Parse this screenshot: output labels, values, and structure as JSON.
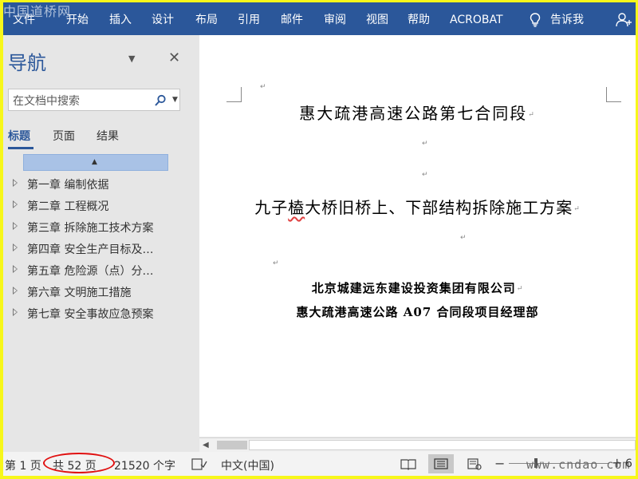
{
  "watermark": "中国道桥网",
  "ribbon": {
    "tabs": [
      "文件",
      "开始",
      "插入",
      "设计",
      "布局",
      "引用",
      "邮件",
      "审阅",
      "视图",
      "帮助",
      "ACROBAT"
    ],
    "tell_me": "告诉我",
    "tell_icon": "lightbulb-icon",
    "share_icon": "share-person-icon"
  },
  "navigation": {
    "title": "导航",
    "search_placeholder": "在文档中搜索",
    "tabs": [
      "标题",
      "页面",
      "结果"
    ],
    "active_tab": "标题",
    "headings": [
      "第一章 编制依据",
      "第二章 工程概况",
      "第三章 拆除施工技术方案",
      "第四章 安全生产目标及…",
      "第五章 危险源（点）分…",
      "第六章 文明施工措施",
      "第七章 安全事故应急预案"
    ]
  },
  "document": {
    "line1": "惠大疏港高速公路第七合同段",
    "line2_pre": "九子",
    "line2_squiggle": "榼",
    "line2_post": "大桥旧桥上、下部结构拆除施工方案",
    "line3": "北京城建远东建设投资集团有限公司",
    "line4": "惠大疏港高速公路 A07 合同段项目经理部",
    "paragraph_mark": "↵"
  },
  "status_bar": {
    "page": "第 1 页",
    "total_pages": "共 52 页",
    "word_count": "21520 个字",
    "language": "中文(中国)",
    "zoom_suffix": "6",
    "site_watermark": "www.cndao.com"
  },
  "colors": {
    "ribbon": "#2b579a",
    "highlight_ellipse": "#e01010",
    "border_frame": "#f7f71a"
  }
}
